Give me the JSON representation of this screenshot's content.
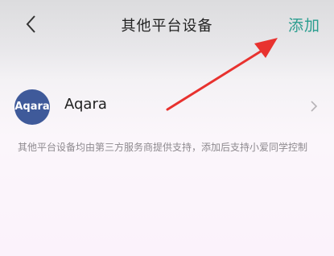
{
  "header": {
    "back_icon": "chevron-left-icon",
    "title": "其他平台设备",
    "add_label": "添加"
  },
  "devices": [
    {
      "logo_text": "Aqara",
      "name": "Aqara",
      "chevron_icon": "chevron-right-icon"
    }
  ],
  "note": "其他平台设备均由第三方服务商提供支持，添加后支持小爱同学控制",
  "colors": {
    "accent": "#2a9d8f",
    "annotation_arrow": "#e8322f",
    "logo_bg": "#3f5a9a"
  }
}
